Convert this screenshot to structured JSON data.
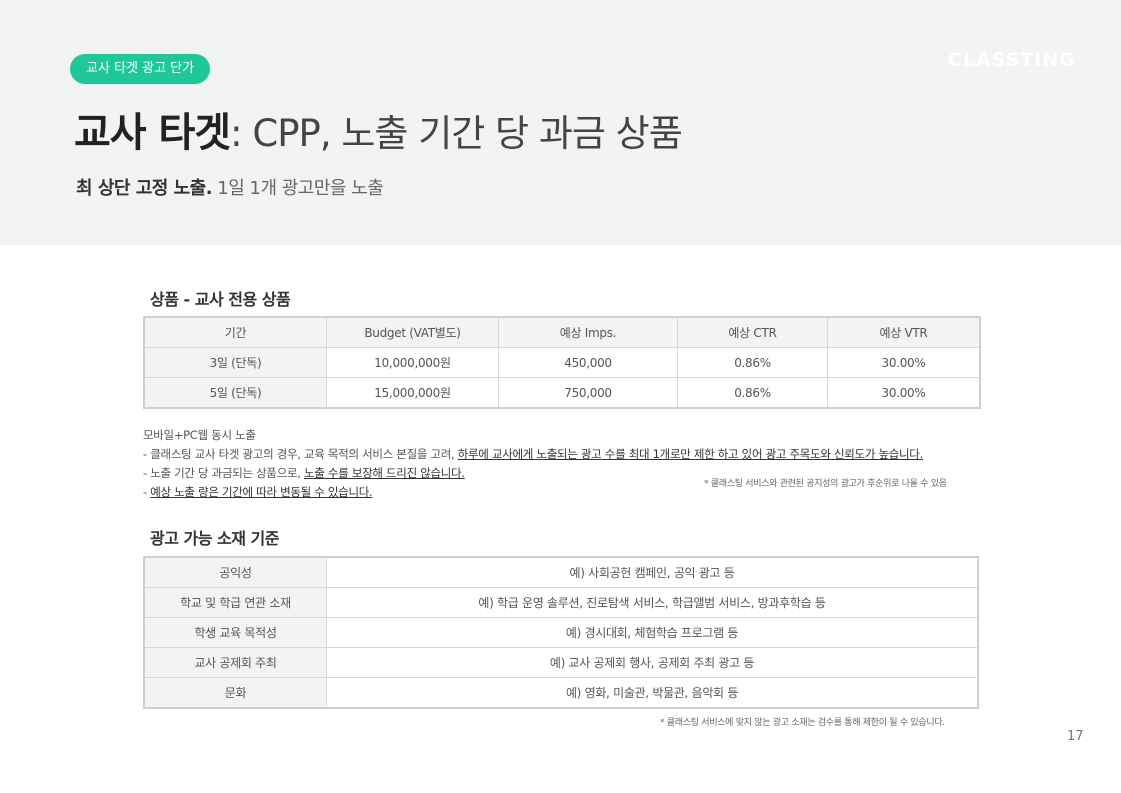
{
  "header": {
    "pill": "교사 타겟 광고 단가",
    "brand": "CLASSTING",
    "title_strong": "교사 타겟",
    "title_light": ": CPP, 노출 기간 당 과금 상품",
    "subtitle_strong": "최 상단 고정 노출.",
    "subtitle_light": " 1일 1개 광고만을 노출"
  },
  "product": {
    "section_title": "상품 - 교사 전용 상품",
    "columns": [
      "기간",
      "Budget (VAT별도)",
      "예상 Imps.",
      "예상 CTR",
      "예상 VTR"
    ],
    "rows": [
      [
        "3일 (단독)",
        "10,000,000원",
        "450,000",
        "0.86%",
        "30.00%"
      ],
      [
        "5일 (단독)",
        "15,000,000원",
        "750,000",
        "0.86%",
        "30.00%"
      ]
    ]
  },
  "notes": {
    "line1": "모바일+PC웹 동시 노출",
    "line2_plain": "- 클래스팅 교사 타겟 광고의 경우, 교육 목적의 서비스 본질을 고려, ",
    "line2_underline": "하루에 교사에게 노출되는 광고 수를 최대 1개로만 제한 하고 있어 광고 주목도와 신뢰도가 높습니다.",
    "line3_plain": "- 노출 기간 당 과금되는 상품으로, ",
    "line3_underline": "노출 수를 보장해 드리진 않습니다.",
    "line4_plain": "- ",
    "line4_underline": "예상 노출 량은 기간에 따라 변동될 수 있습니다.",
    "footnote": "* 클래스팅 서비스와 관련된 공지성의 광고가 후순위로 나올 수 있음"
  },
  "creative": {
    "section_title": "광고 가능 소재 기준",
    "rows": [
      [
        "공익성",
        "예) 사회공헌 캠페인, 공익 광고 등"
      ],
      [
        "학교 및 학급 연관 소재",
        "예) 학급 운영 솔루션, 진로탐색 서비스, 학급앨범 서비스, 방과후학습 등"
      ],
      [
        "학생 교육 목적성",
        "예) 경시대회, 체험학습 프로그램 등"
      ],
      [
        "교사 공제회 주최",
        "예) 교사 공제회 행사, 공제회 주최 광고 등"
      ],
      [
        "문화",
        "예) 영화, 미술관, 박물관, 음악회 등"
      ]
    ],
    "footnote": "* 클래스팅 서비스에 맞지 않는 광고 소재는 검수를 통해 제한이 될 수 있습니다."
  },
  "page_number": "17"
}
